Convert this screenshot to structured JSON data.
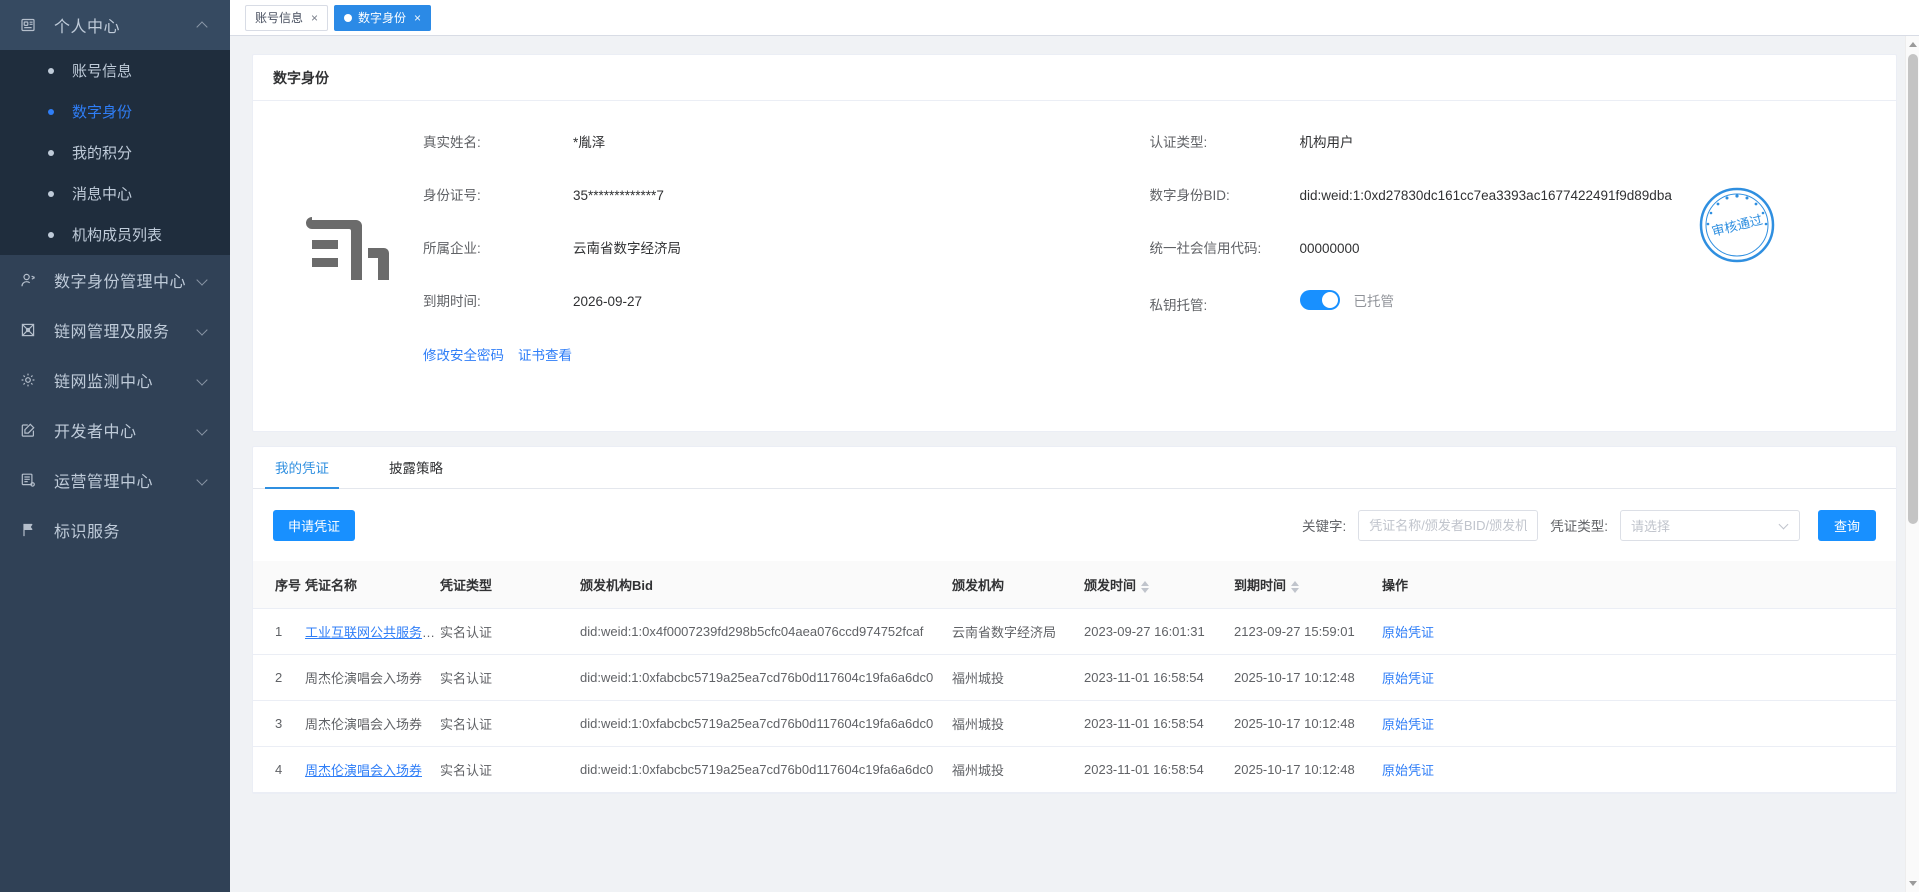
{
  "sidebar": {
    "groups": [
      {
        "label": "个人中心",
        "icon": "id-card-icon",
        "open": true,
        "items": [
          {
            "label": "账号信息",
            "active": false
          },
          {
            "label": "数字身份",
            "active": true
          },
          {
            "label": "我的积分",
            "active": false
          },
          {
            "label": "消息中心",
            "active": false
          },
          {
            "label": "机构成员列表",
            "active": false
          }
        ]
      },
      {
        "label": "数字身份管理中心",
        "icon": "user-add-icon",
        "open": false,
        "items": []
      },
      {
        "label": "链网管理及服务",
        "icon": "network-icon",
        "open": false,
        "items": []
      },
      {
        "label": "链网监测中心",
        "icon": "gear-icon",
        "open": false,
        "items": []
      },
      {
        "label": "开发者中心",
        "icon": "edit-square-icon",
        "open": false,
        "items": []
      },
      {
        "label": "运营管理中心",
        "icon": "report-icon",
        "open": false,
        "items": []
      },
      {
        "label": "标识服务",
        "icon": "flag-icon",
        "open": false,
        "items": [],
        "noCaret": true
      }
    ]
  },
  "tabs": [
    {
      "label": "账号信息",
      "selected": false,
      "close": "×"
    },
    {
      "label": "数字身份",
      "selected": true,
      "close": "×"
    }
  ],
  "profile": {
    "card_title": "数字身份",
    "fields": [
      {
        "key": "真实姓名:",
        "value": "*胤泽"
      },
      {
        "key": "认证类型:",
        "value": "机构用户"
      },
      {
        "key": "身份证号:",
        "value": "35*************7"
      },
      {
        "key": "数字身份BID:",
        "value": "did:weid:1:0xd27830dc161cc7ea3393ac1677422491f9d89dba"
      },
      {
        "key": "所属企业:",
        "value": "云南省数字经济局"
      },
      {
        "key": "统一社会信用代码:",
        "value": "00000000"
      },
      {
        "key": "到期时间:",
        "value": "2026-09-27"
      }
    ],
    "escrow": {
      "key": "私钥托管:",
      "state_label": "已托管",
      "on": true
    },
    "links": [
      {
        "label": "修改安全密码"
      },
      {
        "label": "证书查看"
      }
    ],
    "seal_text": "审核通过",
    "seal_color": "#2f8fe0"
  },
  "credentials": {
    "tabs": [
      {
        "label": "我的凭证",
        "on": true
      },
      {
        "label": "披露策略",
        "on": false
      }
    ],
    "apply_button": "申请凭证",
    "keyword_label": "关键字:",
    "keyword_value": "",
    "keyword_placeholder": "凭证名称/颁发者BID/颁发机",
    "type_label": "凭证类型:",
    "type_value": "请选择",
    "search_button": "查询",
    "columns": [
      "序号",
      "凭证名称",
      "凭证类型",
      "颁发机构Bid",
      "颁发机构",
      "颁发时间",
      "到期时间",
      "操作"
    ],
    "sortable_columns": [
      "颁发时间",
      "到期时间"
    ],
    "rows": [
      {
        "序号": "1",
        "凭证名称": "工业互联网公共服务平...",
        "凭证名称_link": true,
        "凭证类型": "实名认证",
        "颁发机构Bid": "did:weid:1:0x4f0007239fd298b5cfc04aea076ccd974752fcaf",
        "颁发机构": "云南省数字经济局",
        "颁发时间": "2023-09-27 16:01:31",
        "到期时间": "2123-09-27 15:59:01",
        "操作": "原始凭证"
      },
      {
        "序号": "2",
        "凭证名称": "周杰伦演唱会入场券",
        "凭证名称_link": false,
        "凭证类型": "实名认证",
        "颁发机构Bid": "did:weid:1:0xfabcbc5719a25ea7cd76b0d117604c19fa6a6dc0",
        "颁发机构": "福州城投",
        "颁发时间": "2023-11-01 16:58:54",
        "到期时间": "2025-10-17 10:12:48",
        "操作": "原始凭证"
      },
      {
        "序号": "3",
        "凭证名称": "周杰伦演唱会入场券",
        "凭证名称_link": false,
        "凭证类型": "实名认证",
        "颁发机构Bid": "did:weid:1:0xfabcbc5719a25ea7cd76b0d117604c19fa6a6dc0",
        "颁发机构": "福州城投",
        "颁发时间": "2023-11-01 16:58:54",
        "到期时间": "2025-10-17 10:12:48",
        "操作": "原始凭证"
      },
      {
        "序号": "4",
        "凭证名称": "周杰伦演唱会入场券",
        "凭证名称_link": true,
        "凭证类型": "实名认证",
        "颁发机构Bid": "did:weid:1:0xfabcbc5719a25ea7cd76b0d117604c19fa6a6dc0",
        "颁发机构": "福州城投",
        "颁发时间": "2023-11-01 16:58:54",
        "到期时间": "2025-10-17 10:12:48",
        "操作": "原始凭证"
      }
    ]
  },
  "theme": {
    "sidebar_bg": "#304156",
    "sidebar_sub_bg": "#1f2d3d",
    "accent": "#2f7ef7",
    "primary": "#1890ff",
    "tab_blue": "#2b8ae6"
  }
}
